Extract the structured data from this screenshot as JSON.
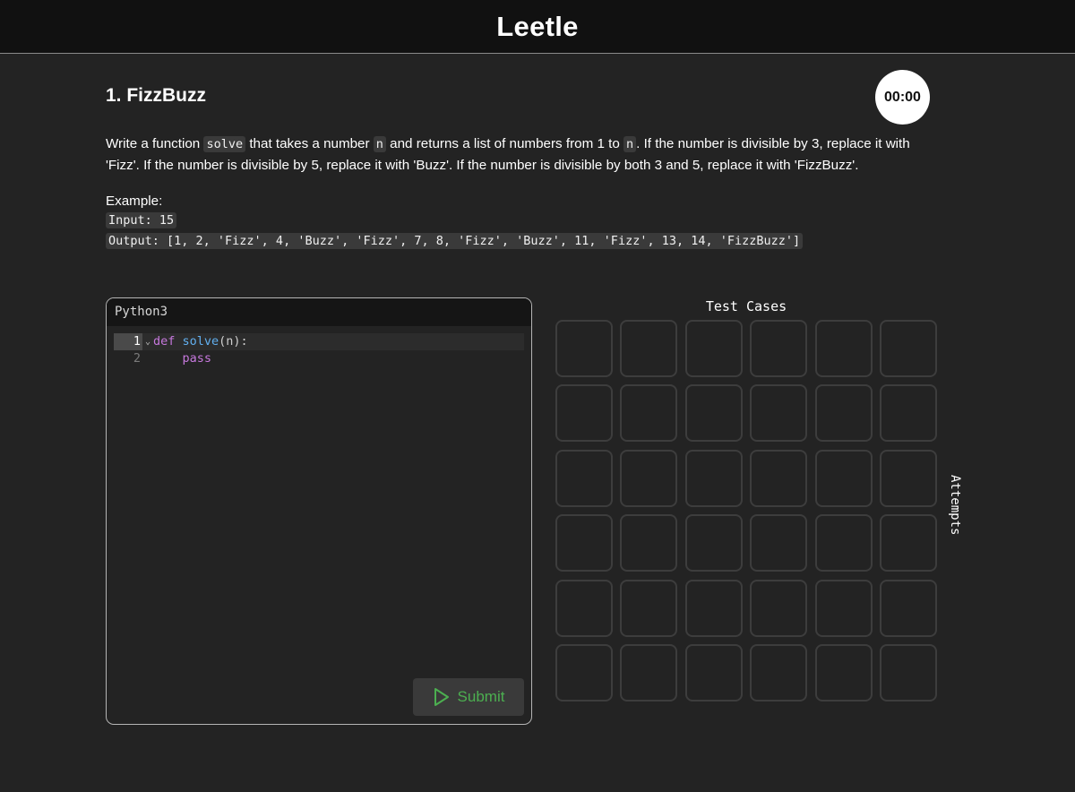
{
  "header": {
    "logo": "Leetle"
  },
  "problem": {
    "title": "1. FizzBuzz",
    "timer": "00:00",
    "desc_parts": [
      "Write a function ",
      "solve",
      " that takes a number ",
      "n",
      " and returns a list of numbers from 1 to ",
      "n",
      ". If the number is divisible by 3, replace it with 'Fizz'. If the number is divisible by 5, replace it with 'Buzz'. If the number is divisible by both 3 and 5, replace it with 'FizzBuzz'."
    ],
    "example_label": "Example:",
    "example_input": "Input: 15",
    "example_output": "Output: [1, 2, 'Fizz', 4, 'Buzz', 'Fizz', 7, 8, 'Fizz', 'Buzz', 11, 'Fizz', 13, 14, 'FizzBuzz']"
  },
  "editor": {
    "language": "Python3",
    "lines": [
      {
        "number": "1",
        "tokens": [
          [
            "kw",
            "def"
          ],
          [
            "pn",
            " "
          ],
          [
            "fn",
            "solve"
          ],
          [
            "pn",
            "(n):"
          ]
        ]
      },
      {
        "number": "2",
        "tokens": [
          [
            "pn",
            "    "
          ],
          [
            "kw",
            "pass"
          ]
        ]
      }
    ],
    "submit_label": "Submit",
    "colors": {
      "submit": "#4caf50",
      "keyword": "#c678dd",
      "function": "#61afef"
    }
  },
  "tests": {
    "title": "Test Cases",
    "rows": 6,
    "cols": 6,
    "side_label": "Attempts"
  }
}
